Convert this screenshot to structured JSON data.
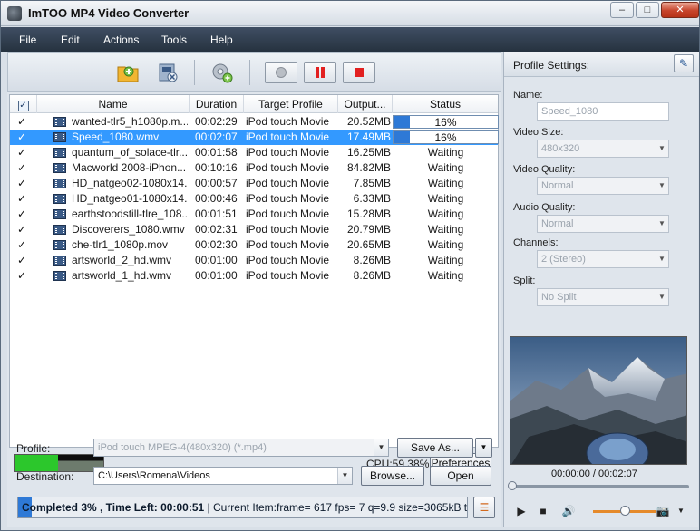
{
  "window": {
    "title": "ImTOO MP4 Video Converter"
  },
  "menu": [
    "File",
    "Edit",
    "Actions",
    "Tools",
    "Help"
  ],
  "list": {
    "headers": {
      "name": "Name",
      "duration": "Duration",
      "profile": "Target Profile",
      "output": "Output...",
      "status": "Status"
    },
    "rows": [
      {
        "name": "wanted-tlr5_h1080p.m...",
        "duration": "00:02:29",
        "profile": "iPod touch Movie",
        "output": "20.52MB",
        "status": "16%",
        "progress": 0.16,
        "selected": false
      },
      {
        "name": "Speed_1080.wmv",
        "duration": "00:02:07",
        "profile": "iPod touch Movie",
        "output": "17.49MB",
        "status": "16%",
        "progress": 0.16,
        "selected": true
      },
      {
        "name": "quantum_of_solace-tlr...",
        "duration": "00:01:58",
        "profile": "iPod touch Movie",
        "output": "16.25MB",
        "status": "Waiting",
        "selected": false
      },
      {
        "name": "Macworld 2008-iPhon...",
        "duration": "00:10:16",
        "profile": "iPod touch Movie",
        "output": "84.82MB",
        "status": "Waiting",
        "selected": false
      },
      {
        "name": "HD_natgeo02-1080x14...",
        "duration": "00:00:57",
        "profile": "iPod touch Movie",
        "output": "7.85MB",
        "status": "Waiting",
        "selected": false
      },
      {
        "name": "HD_natgeo01-1080x14...",
        "duration": "00:00:46",
        "profile": "iPod touch Movie",
        "output": "6.33MB",
        "status": "Waiting",
        "selected": false
      },
      {
        "name": "earthstoodstill-tlre_108...",
        "duration": "00:01:51",
        "profile": "iPod touch Movie",
        "output": "15.28MB",
        "status": "Waiting",
        "selected": false
      },
      {
        "name": "Discoverers_1080.wmv",
        "duration": "00:02:31",
        "profile": "iPod touch Movie",
        "output": "20.79MB",
        "status": "Waiting",
        "selected": false
      },
      {
        "name": "che-tlr1_1080p.mov",
        "duration": "00:02:30",
        "profile": "iPod touch Movie",
        "output": "20.65MB",
        "status": "Waiting",
        "selected": false
      },
      {
        "name": "artsworld_2_hd.wmv",
        "duration": "00:01:00",
        "profile": "iPod touch Movie",
        "output": "8.26MB",
        "status": "Waiting",
        "selected": false
      },
      {
        "name": "artsworld_1_hd.wmv",
        "duration": "00:01:00",
        "profile": "iPod touch Movie",
        "output": "8.26MB",
        "status": "Waiting",
        "selected": false
      }
    ]
  },
  "cpu": {
    "text": "CPU:59.38%",
    "preferences_label": "Preferences"
  },
  "profile": {
    "label": "Profile:",
    "value": "iPod touch MPEG-4(480x320) (*.mp4)",
    "save_as_label": "Save As..."
  },
  "destination": {
    "label": "Destination:",
    "value": "C:\\Users\\Romena\\Videos",
    "browse_label": "Browse...",
    "open_label": "Open"
  },
  "status": {
    "main": "Completed 3% , Time Left: 00:00:51",
    "detail": "| Current Item:frame=  617 fps=  7 q=9.9 size=3065kB t...",
    "progress": 0.03
  },
  "settings": {
    "title": "Profile Settings:",
    "name_label": "Name:",
    "name_value": "Speed_1080",
    "video_size_label": "Video Size:",
    "video_size_value": "480x320",
    "video_quality_label": "Video Quality:",
    "video_quality_value": "Normal",
    "audio_quality_label": "Audio Quality:",
    "audio_quality_value": "Normal",
    "channels_label": "Channels:",
    "channels_value": "2 (Stereo)",
    "split_label": "Split:",
    "split_value": "No Split"
  },
  "player": {
    "time": "00:00:00 / 00:02:07",
    "volume": 0.5
  },
  "colors": {
    "accent": "#2e79d6",
    "selection": "#3399ff",
    "menubar": "#2f3c4e"
  }
}
